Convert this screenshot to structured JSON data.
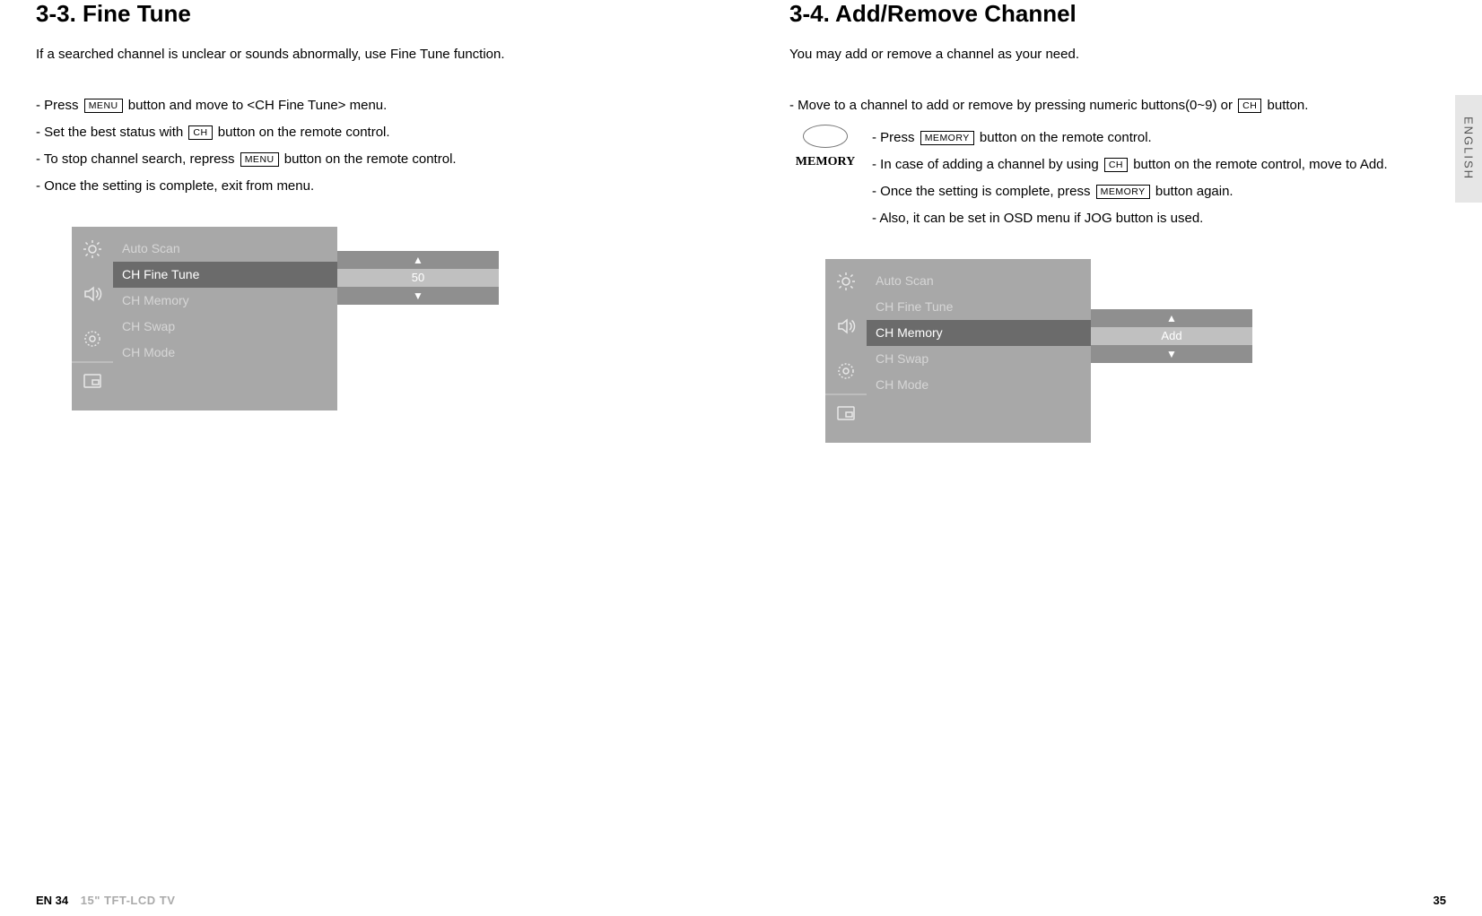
{
  "side_tab": "ENGLISH",
  "left": {
    "heading": "3-3. Fine Tune",
    "intro": "If a searched channel is unclear or sounds abnormally, use Fine Tune function.",
    "steps": {
      "s1_a": "- Press ",
      "s1_btn": "MENU",
      "s1_b": " button and move to <CH Fine Tune> menu.",
      "s2_a": "- Set the best status with ",
      "s2_btn": "CH",
      "s2_b": " button on the remote control.",
      "s3_a": "- To stop channel search, repress ",
      "s3_btn": "MENU",
      "s3_b": " button on the remote control.",
      "s4": "- Once the setting is complete, exit from menu."
    },
    "osd": {
      "items": [
        "Auto Scan",
        "CH Fine Tune",
        "CH Memory",
        "CH Swap",
        "CH Mode"
      ],
      "selected_index": 1,
      "value": "50"
    }
  },
  "right": {
    "heading": "3-4. Add/Remove Channel",
    "intro": "You may add or remove a channel as your need.",
    "top": {
      "a": "- Move to a channel to add or remove by pressing numeric buttons(0~9) or ",
      "btn": "CH",
      "b": " button."
    },
    "memory_label": "MEMORY",
    "mem": {
      "s1_a": "- Press ",
      "s1_btn": "MEMORY",
      "s1_b": " button on the remote control.",
      "s2_a": "- In case of adding a channel by using ",
      "s2_btn": "CH",
      "s2_b": " button on the remote control, move to Add.",
      "s3_a": "- Once the setting is complete, press ",
      "s3_btn": "MEMORY",
      "s3_b": " button again.",
      "s4": "- Also, it can be set in OSD menu if JOG button is used."
    },
    "osd": {
      "items": [
        "Auto Scan",
        "CH Fine Tune",
        "CH Memory",
        "CH Swap",
        "CH Mode"
      ],
      "selected_index": 2,
      "value": "Add"
    }
  },
  "footer": {
    "left_page": "EN 34",
    "left_title": "15\" TFT-LCD TV",
    "right_page": "35"
  }
}
